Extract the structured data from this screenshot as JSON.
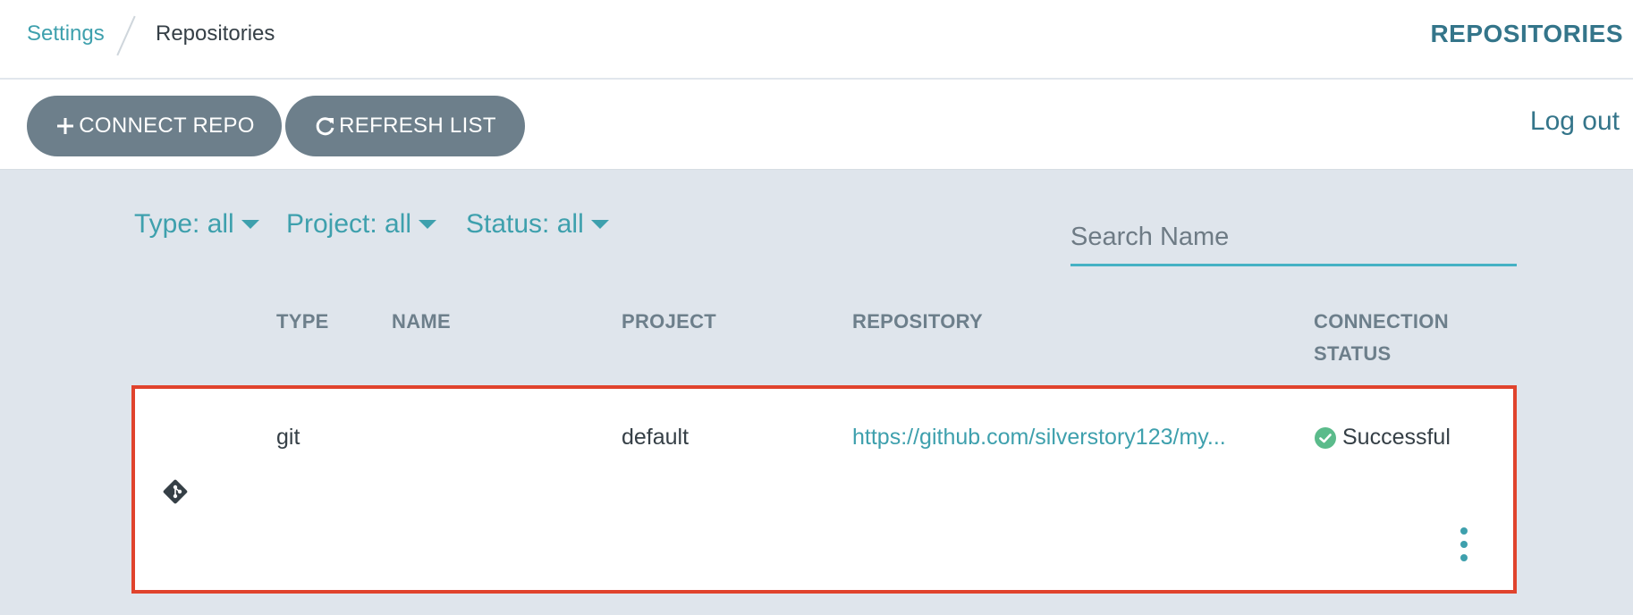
{
  "breadcrumb": {
    "parent": "Settings",
    "current": "Repositories"
  },
  "header": {
    "title": "REPOSITORIES"
  },
  "toolbar": {
    "connect_label": "CONNECT REPO",
    "refresh_label": "REFRESH LIST",
    "logout_label": "Log out"
  },
  "filters": {
    "type": "Type: all",
    "project": "Project: all",
    "status": "Status: all"
  },
  "search": {
    "placeholder": "Search Name",
    "value": ""
  },
  "table": {
    "columns": [
      "TYPE",
      "NAME",
      "PROJECT",
      "REPOSITORY",
      "CONNECTION STATUS"
    ],
    "rows": [
      {
        "icon": "git-icon",
        "type": "git",
        "name": "",
        "project": "default",
        "repository": "https://github.com/silverstory123/my...",
        "status": "Successful",
        "status_icon": "check-circle-icon"
      }
    ]
  },
  "colors": {
    "accent": "#3ea0ad",
    "heading": "#34758a",
    "button": "#6d7f8b",
    "success": "#5bbb8b",
    "highlight_border": "#e0432d",
    "page_bg": "#dfe5ec"
  }
}
